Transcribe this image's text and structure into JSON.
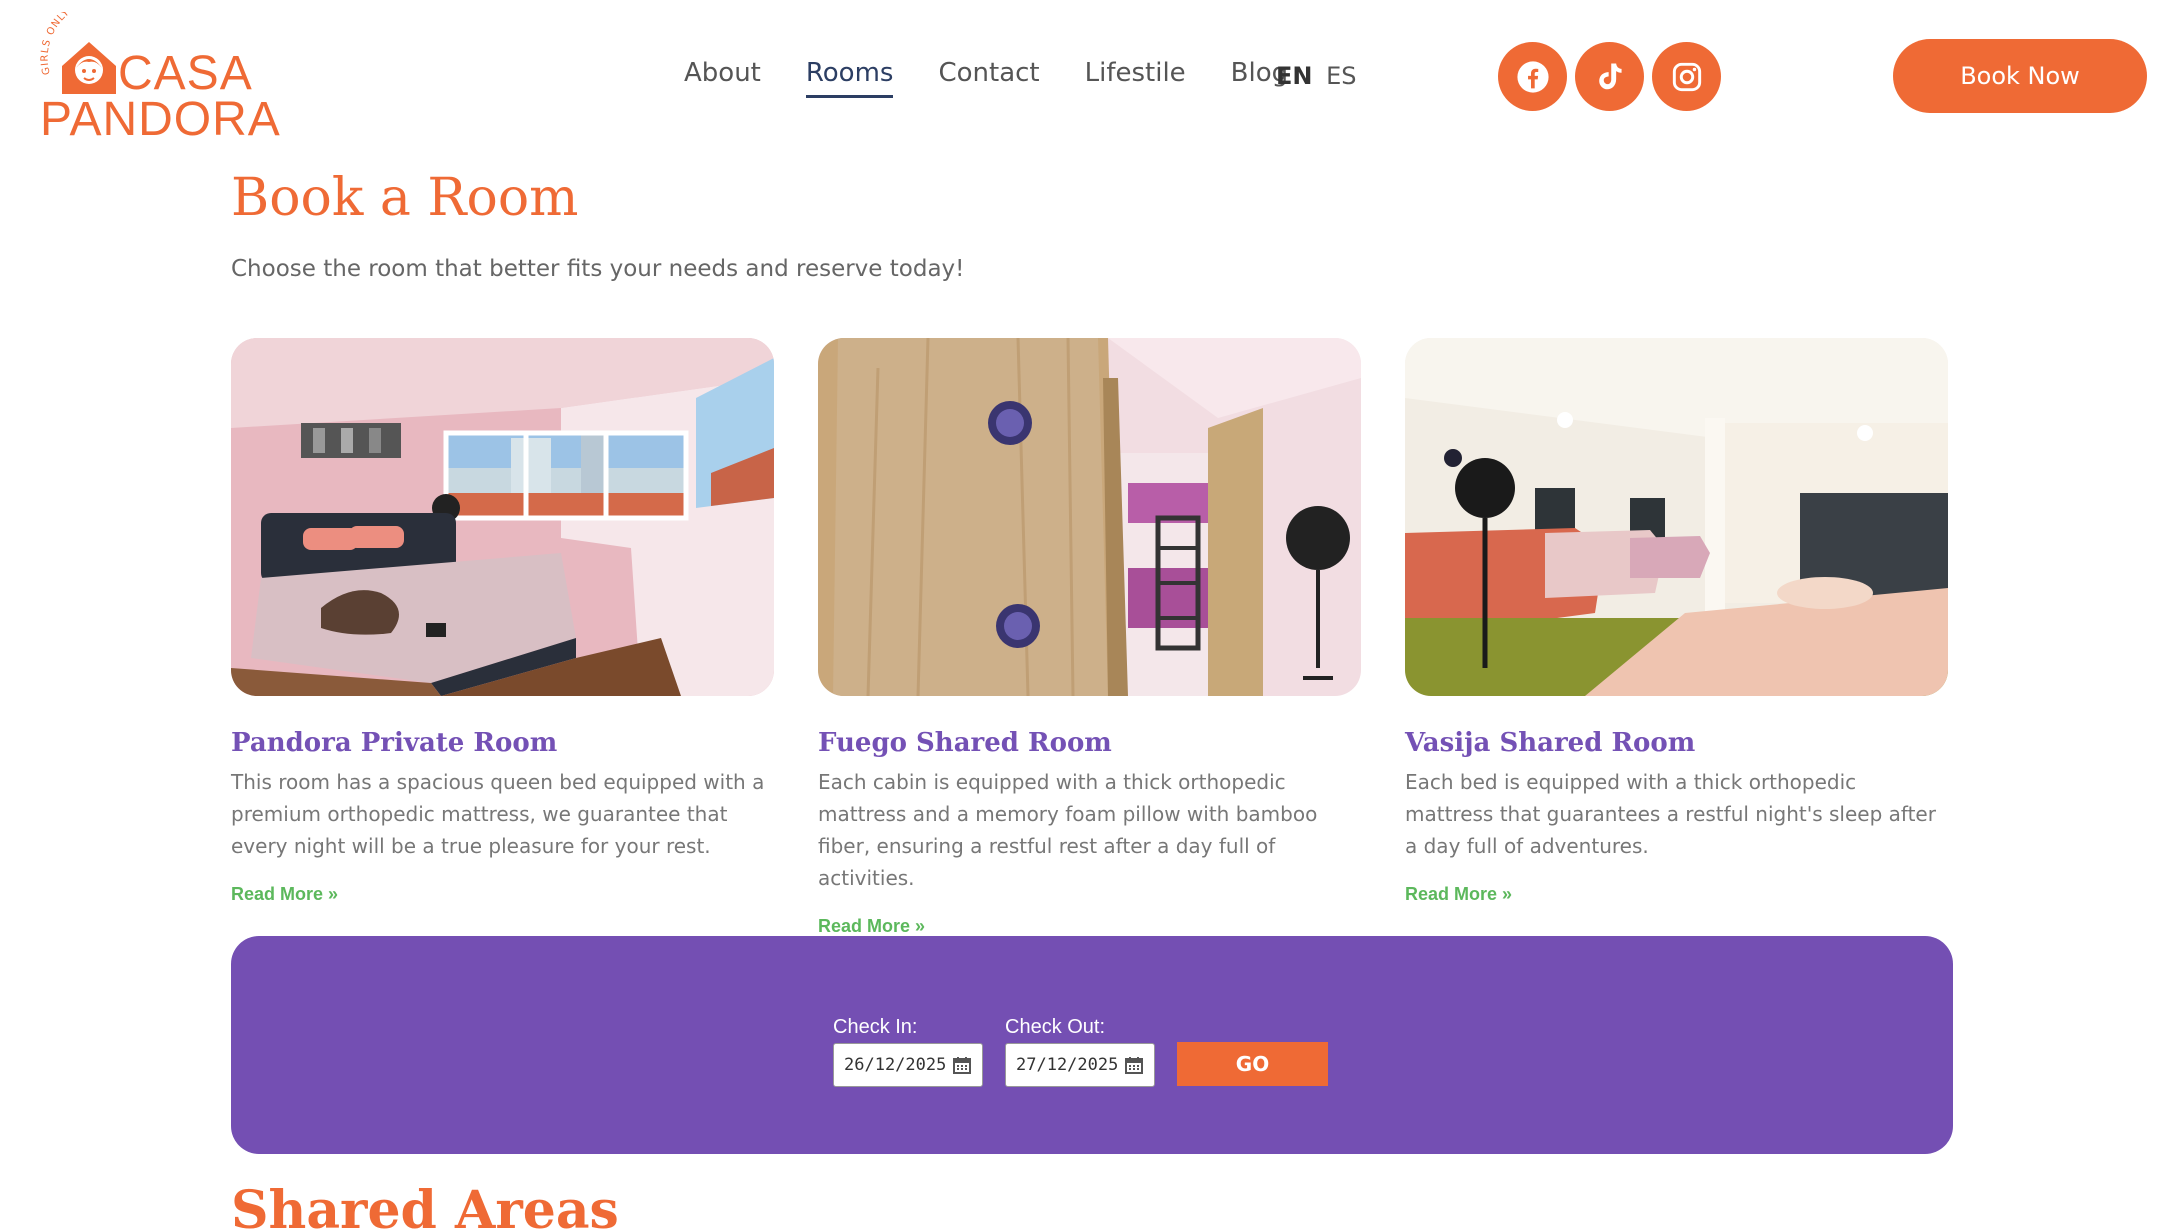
{
  "header": {
    "logo": {
      "arc_text": "GIRLS ONLY HOSTEL",
      "line1": "CASA",
      "line2": "PANDORA"
    },
    "nav": [
      {
        "label": "About"
      },
      {
        "label": "Rooms",
        "active": true
      },
      {
        "label": "Contact"
      },
      {
        "label": "Lifestile"
      },
      {
        "label": "Blog"
      }
    ],
    "lang": {
      "en": "EN",
      "es": "ES"
    },
    "socials": [
      "facebook-icon",
      "tiktok-icon",
      "instagram-icon"
    ],
    "book_now": "Book Now"
  },
  "colors": {
    "accent": "#ef6a35",
    "purple": "#744fb3",
    "link_green": "#5cb85c"
  },
  "page": {
    "title": "Book a Room",
    "subtitle": "Choose the room that better fits your needs and reserve today!"
  },
  "rooms": [
    {
      "title": "Pandora Private Room",
      "description": "This room has a spacious queen bed equipped with a premium orthopedic mattress, we guarantee that every night will be a true pleasure for your rest.",
      "link": "Read More »"
    },
    {
      "title": "Fuego Shared Room",
      "description": "Each cabin is equipped with a thick orthopedic mattress and a memory foam pillow with bamboo fiber, ensuring a restful rest after a day full of activities.",
      "link": "Read More »"
    },
    {
      "title": "Vasija Shared Room",
      "description": "Each bed is equipped with a thick orthopedic mattress that guarantees a restful night's sleep after a day full of adventures.",
      "link": "Read More »"
    }
  ],
  "booking": {
    "check_in_label": "Check In:",
    "check_in_value": "26/12/2025",
    "check_out_label": "Check Out:",
    "check_out_value": "27/12/2025",
    "go_label": "GO"
  },
  "next_section": {
    "title": "Shared Areas"
  }
}
